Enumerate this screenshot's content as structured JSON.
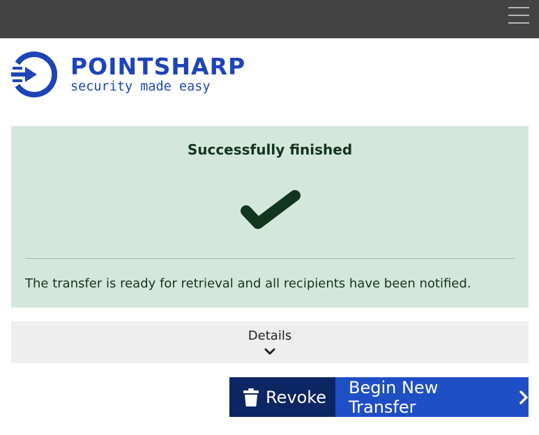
{
  "header": {
    "menu_icon": "hamburger-menu-icon"
  },
  "brand": {
    "name": "POINTSHARP",
    "tagline": "security made easy",
    "color": "#1f44b8"
  },
  "result": {
    "title": "Successfully finished",
    "icon": "checkmark-icon",
    "message": "The transfer is ready for retrieval and all recipients have been notified.",
    "background": "#d4e7dc"
  },
  "details": {
    "label": "Details",
    "icon": "chevron-down-icon"
  },
  "actions": {
    "revoke_label": "Revoke",
    "revoke_icon": "trash-icon",
    "begin_label": "Begin New Transfer",
    "begin_icon": "chevron-right-icon"
  }
}
